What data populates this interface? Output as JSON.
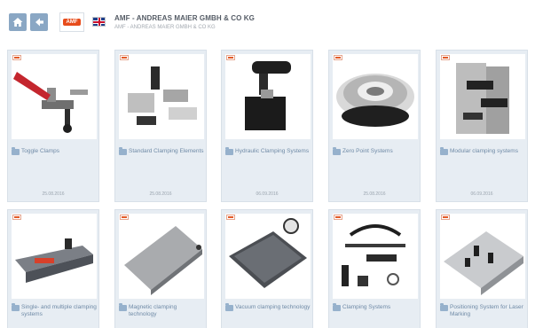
{
  "header": {
    "home_icon": "home-icon",
    "back_icon": "arrow-left-icon",
    "brand": "AMF",
    "flag_icon": "uk-flag-icon",
    "company_title": "AMF - ANDREAS MAIER GMBH & CO KG",
    "company_subtitle": "AMF - ANDREAS MAIER GMBH & CO KG"
  },
  "colors": {
    "accent": "#8aa7c4",
    "card_bg": "#e7edf3",
    "link": "#6f8aa6",
    "brand_orange": "#e74c1b"
  },
  "categories": [
    {
      "label": "Toggle Clamps",
      "date": "25.08.2016"
    },
    {
      "label": "Standard Clamping Elements",
      "date": "25.08.2016"
    },
    {
      "label": "Hydraulic Clamping Systems",
      "date": "06.09.2016"
    },
    {
      "label": "Zero Point Systems",
      "date": "25.08.2016"
    },
    {
      "label": "Modular clamping systems",
      "date": "06.09.2016"
    },
    {
      "label": "Single- and multiple clamping systems",
      "date": ""
    },
    {
      "label": "Magnetic clamping technology",
      "date": ""
    },
    {
      "label": "Vacuum clamping technology",
      "date": ""
    },
    {
      "label": "Clamping Systems",
      "date": ""
    },
    {
      "label": "Positioning System for Laser Marking",
      "date": ""
    }
  ]
}
